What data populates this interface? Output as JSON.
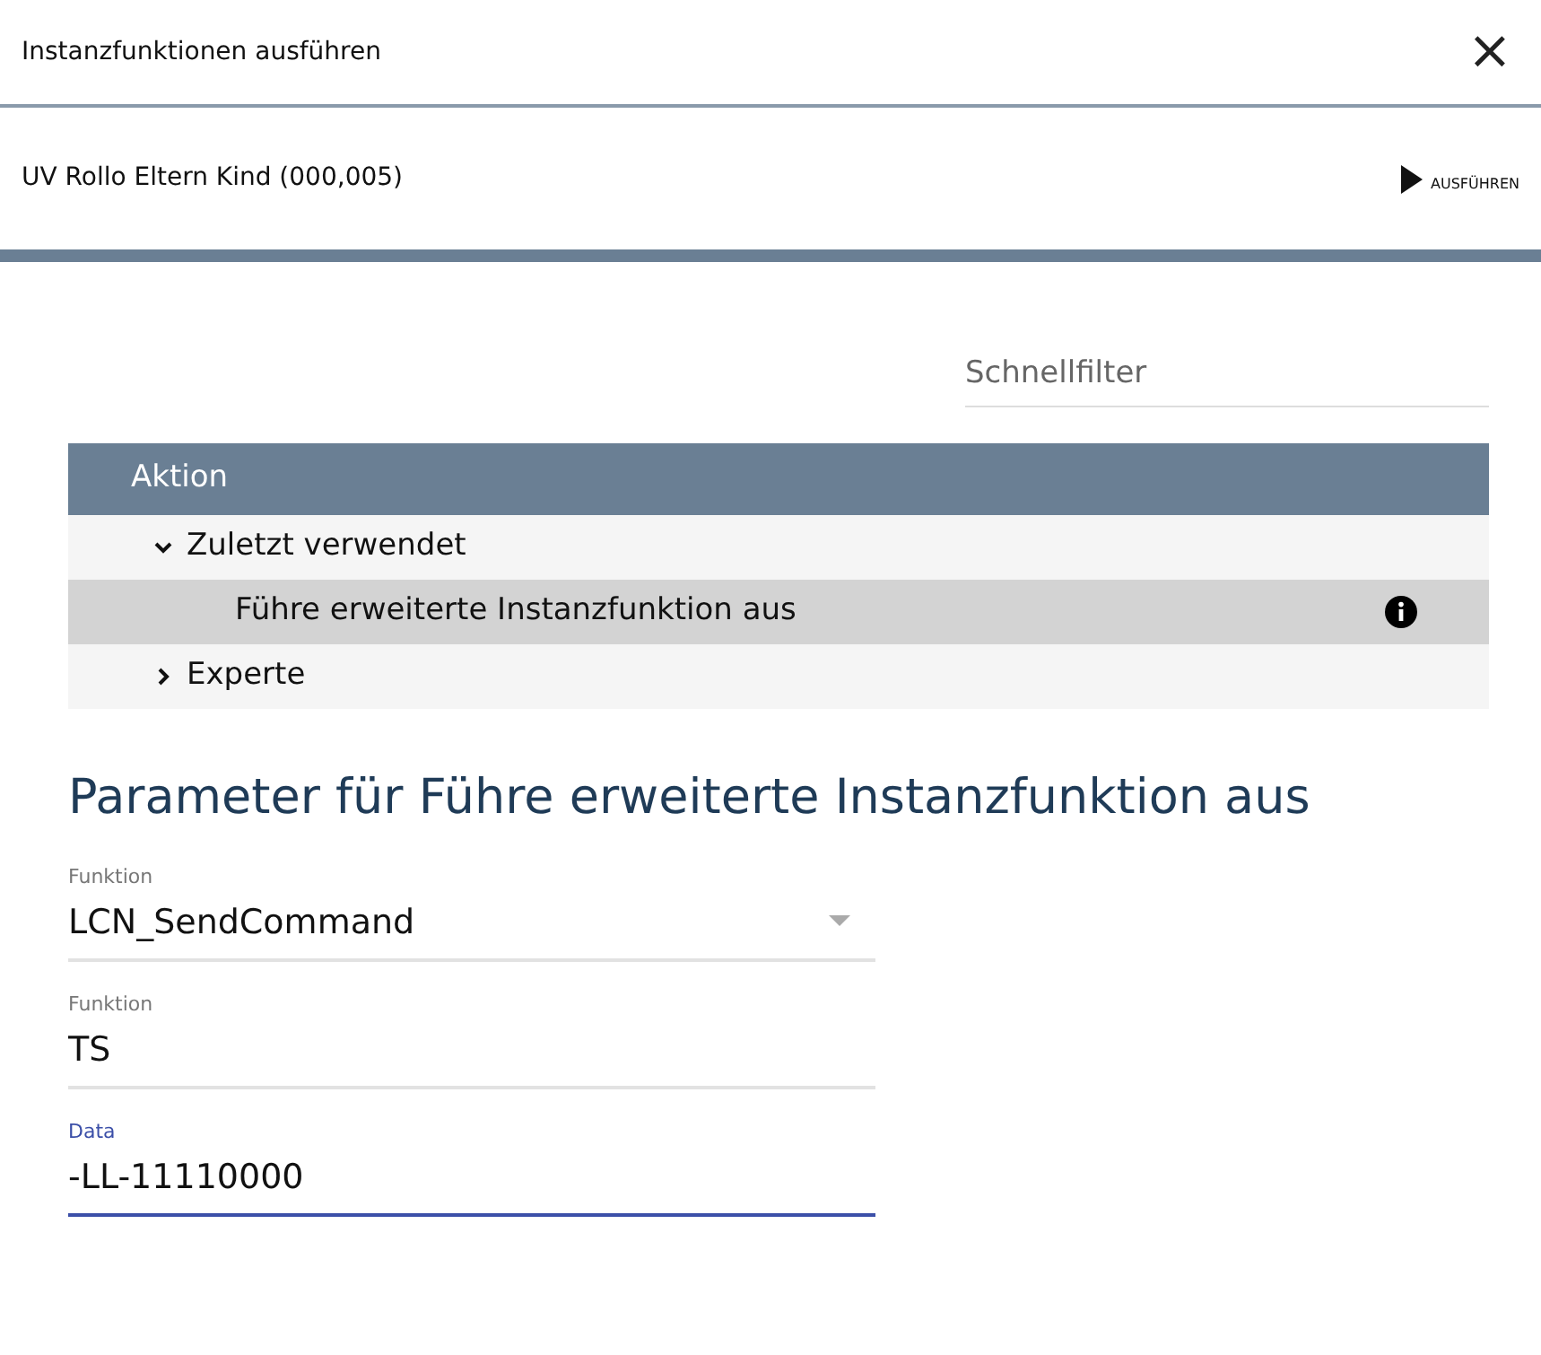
{
  "dialog": {
    "title": "Instanzfunktionen ausführen",
    "close": "×"
  },
  "target": {
    "name": "UV Rollo Eltern Kind (000,005)",
    "run_label": "AUSFÜHREN"
  },
  "filter": {
    "placeholder": "Schnellfilter"
  },
  "tree": {
    "column": "Aktion",
    "items": [
      {
        "label": "Zuletzt verwendet",
        "expanded": true,
        "selected": false,
        "children": [
          {
            "label": "Führe erweiterte Instanzfunktion aus",
            "selected": true,
            "info": true
          }
        ]
      },
      {
        "label": "Experte",
        "expanded": false,
        "selected": false
      }
    ]
  },
  "params": {
    "heading": "Parameter für Führe erweiterte Instanzfunktion aus",
    "fields": [
      {
        "kind": "select",
        "label": "Funktion",
        "value": "LCN_SendCommand",
        "focused": false
      },
      {
        "kind": "text",
        "label": "Funktion",
        "value": "TS",
        "focused": false
      },
      {
        "kind": "text",
        "label": "Data",
        "value": "-LL-11110000",
        "focused": true
      }
    ]
  }
}
